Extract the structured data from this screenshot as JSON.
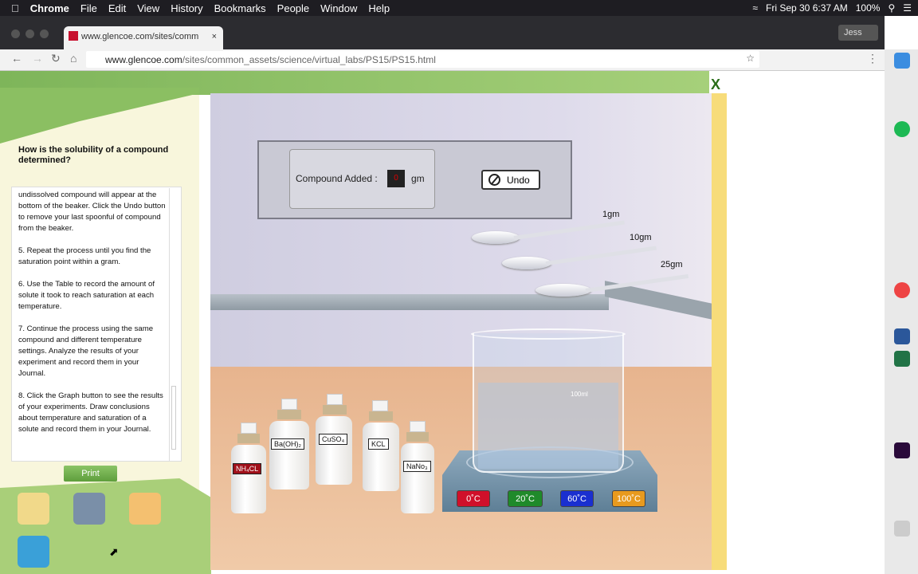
{
  "menubar": {
    "app": "Chrome",
    "items": [
      "File",
      "Edit",
      "View",
      "History",
      "Bookmarks",
      "People",
      "Window",
      "Help"
    ],
    "datetime": "Fri Sep 30  6:37 AM",
    "battery": "100%"
  },
  "browser": {
    "tab_title": "www.glencoe.com/sites/comm",
    "profile": "Jess",
    "url_host": "www.glencoe.com",
    "url_path": "/sites/common_assets/science/virtual_labs/PS15/PS15.html"
  },
  "lab": {
    "question": "How is the solubility of a compound determined?",
    "instructions": [
      "undissolved compound will appear at the bottom of the beaker. Click the Undo button to remove your last spoonful of compound from the beaker.",
      "5. Repeat the process until you find the saturation point within a gram.",
      "6. Use the Table to record the amount of solute it took to reach saturation at each temperature.",
      "7. Continue the process using the same compound and different temperature settings. Analyze the results of your experiment and record them in your Journal.",
      "8. Click the Graph button to see the results of your experiments. Draw conclusions about temperature and saturation of a solute and record them in your Journal."
    ],
    "print": "Print",
    "close": "X",
    "compound_label": "Compound Added :",
    "compound_value": "0",
    "unit": "gm",
    "undo": "Undo",
    "spoons": [
      "1gm",
      "10gm",
      "25gm"
    ],
    "beaker_label": "100ml",
    "bottles": [
      "NH₄CL",
      "Ba(OH)₂",
      "CuSO₄",
      "KCL",
      "NaNo₃"
    ],
    "temps": [
      {
        "label": "0˚C",
        "color": "#d0102a"
      },
      {
        "label": "20˚C",
        "color": "#1f8a2a"
      },
      {
        "label": "60˚C",
        "color": "#1a2fd0"
      },
      {
        "label": "100˚C",
        "color": "#e89a1e"
      }
    ]
  }
}
